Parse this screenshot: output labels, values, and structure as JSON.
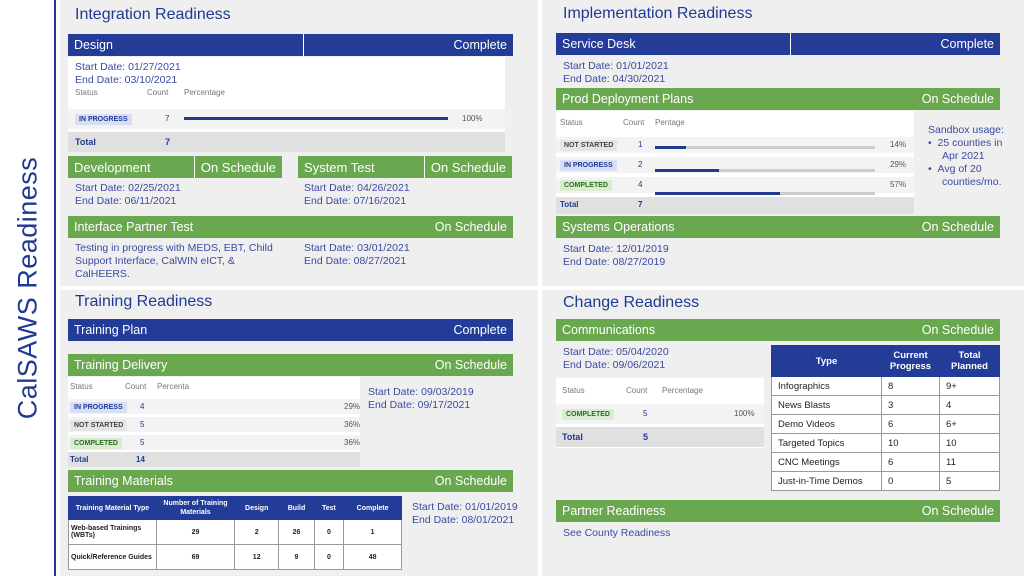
{
  "sidebar": {
    "title": "CalSAWS Readiness"
  },
  "integration": {
    "title": "Integration Readiness",
    "design": {
      "label": "Design",
      "status": "Complete",
      "start": "Start Date: 01/27/2021",
      "end": "End Date: 03/10/2021"
    },
    "design_table": {
      "headers": [
        "Status",
        "Count",
        "Percentage"
      ],
      "rows": [
        {
          "status": "IN PROGRESS",
          "count": "7",
          "percent": "100%",
          "fraction": 1.0
        }
      ],
      "total_label": "Total",
      "total": "7"
    },
    "development": {
      "label": "Development",
      "status": "On Schedule",
      "start": "Start Date: 02/25/2021",
      "end": "End Date: 06/11/2021"
    },
    "system_test": {
      "label": "System Test",
      "status": "On Schedule",
      "start": "Start Date: 04/26/2021",
      "end": "End Date: 07/16/2021"
    },
    "interface": {
      "label": "Interface Partner Test",
      "status": "On Schedule",
      "note1": "Testing in progress with MEDS, EBT, Child",
      "note2": "Support Interface, CalWIN eICT, &",
      "note3": "CalHEERS.",
      "start": "Start Date: 03/01/2021",
      "end": "End Date: 08/27/2021"
    }
  },
  "implementation": {
    "title": "Implementation Readiness",
    "service_desk": {
      "label": "Service Desk",
      "status": "Complete",
      "start": "Start Date: 01/01/2021",
      "end": "End Date: 04/30/2021"
    },
    "prod": {
      "label": "Prod Deployment Plans",
      "status": "On Schedule"
    },
    "prod_table": {
      "headers": [
        "Status",
        "Count",
        "Pentage"
      ],
      "rows": [
        {
          "status": "NOT STARTED",
          "count": "1",
          "percent": "14%",
          "fraction": 0.14
        },
        {
          "status": "IN PROGRESS",
          "count": "2",
          "percent": "29%",
          "fraction": 0.29
        },
        {
          "status": "COMPLETED",
          "count": "4",
          "percent": "57%",
          "fraction": 0.57
        }
      ],
      "total_label": "Total",
      "total": "7"
    },
    "sandbox": {
      "heading": "Sandbox usage:",
      "b1a": "25 counties in",
      "b1b": "Apr 2021",
      "b2a": "Avg of 20",
      "b2b": "counties/mo."
    },
    "sysops": {
      "label": "Systems Operations",
      "status": "On Schedule",
      "start": "Start Date: 12/01/2019",
      "end": "End Date: 08/27/2019"
    }
  },
  "training": {
    "title": "Training Readiness",
    "plan": {
      "label": "Training Plan",
      "status": "Complete"
    },
    "delivery": {
      "label": "Training Delivery",
      "status": "On Schedule",
      "start": "Start Date: 09/03/2019",
      "end": "End Date: 09/17/2021"
    },
    "delivery_table": {
      "headers": [
        "Status",
        "Count",
        "Percenta"
      ],
      "rows": [
        {
          "status": "IN PROGRESS",
          "count": "4",
          "percent": "29%",
          "fraction": 0.29
        },
        {
          "status": "NOT STARTED",
          "count": "5",
          "percent": "36%",
          "fraction": 0.36
        },
        {
          "status": "COMPLETED",
          "count": "5",
          "percent": "36%",
          "fraction": 0.36
        }
      ],
      "total_label": "Total",
      "total": "14"
    },
    "materials": {
      "label": "Training Materials",
      "status": "On Schedule",
      "start": "Start Date: 01/01/2019",
      "end": "End Date: 08/01/2021"
    },
    "materials_table": {
      "headers": [
        "Training Material Type",
        "Number of Training Materials",
        "Design",
        "Build",
        "Test",
        "Complete"
      ],
      "rows": [
        {
          "type": "Web-based Trainings (WBTs)",
          "number": "29",
          "design": "2",
          "build": "26",
          "test": "0",
          "complete": "1"
        },
        {
          "type": "Quick/Reference Guides",
          "number": "69",
          "design": "12",
          "build": "9",
          "test": "0",
          "complete": "48"
        }
      ]
    }
  },
  "change": {
    "title": "Change Readiness",
    "comms": {
      "label": "Communications",
      "status": "On Schedule",
      "start": "Start Date: 05/04/2020",
      "end": "End Date: 09/06/2021"
    },
    "comms_table": {
      "headers": [
        "Status",
        "Count",
        "Percentage"
      ],
      "rows": [
        {
          "status": "COMPLETED",
          "count": "5",
          "percent": "100%",
          "fraction": 1.0
        }
      ],
      "total_label": "Total",
      "total": "5"
    },
    "comm_types": {
      "headers": [
        "Type",
        "Current Progress",
        "Total Planned"
      ],
      "rows": [
        {
          "type": "Infographics",
          "current": "8",
          "total": "9+"
        },
        {
          "type": "News Blasts",
          "current": "3",
          "total": "4"
        },
        {
          "type": "Demo Videos",
          "current": "6",
          "total": "6+"
        },
        {
          "type": "Targeted Topics",
          "current": "10",
          "total": "10"
        },
        {
          "type": "CNC Meetings",
          "current": "6",
          "total": "11"
        },
        {
          "type": "Just-in-Time Demos",
          "current": "0",
          "total": "5"
        }
      ]
    },
    "partner": {
      "label": "Partner Readiness",
      "status": "On Schedule",
      "link": "See County Readiness"
    }
  }
}
